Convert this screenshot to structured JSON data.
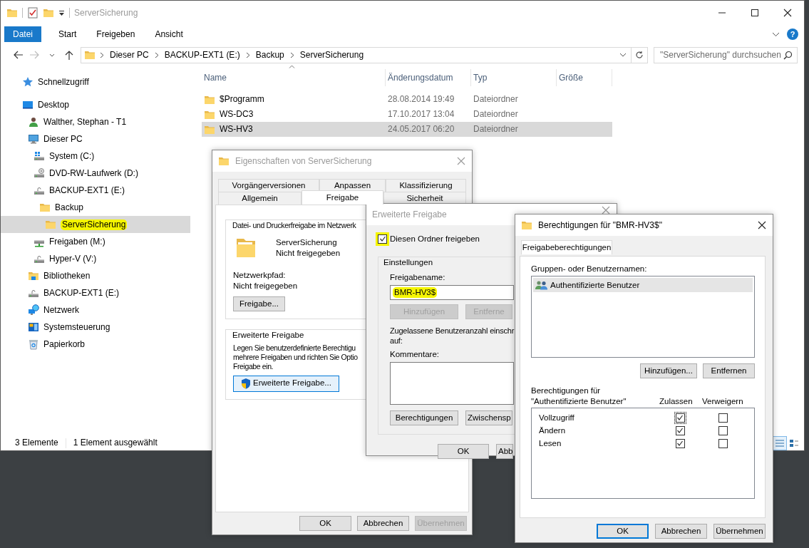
{
  "explorer": {
    "title": "ServerSicherung",
    "ribbon_tabs": [
      {
        "label": "Datei",
        "kind": "filemenu"
      },
      {
        "label": "Start",
        "kind": "tab"
      },
      {
        "label": "Freigeben",
        "kind": "tab"
      },
      {
        "label": "Ansicht",
        "kind": "tab"
      }
    ],
    "help_button": "?",
    "address": {
      "path": [
        "Dieser PC",
        "BACKUP-EXT1 (E:)",
        "Backup",
        "ServerSicherung"
      ]
    },
    "search": {
      "placeholder": "\"ServerSicherung\" durchsuchen"
    },
    "sidebar": {
      "items": [
        {
          "label": "Schnellzugriff",
          "kind": "pinned",
          "selected": false,
          "highlighted": false
        },
        {
          "label": "Desktop",
          "kind": "desktop",
          "selected": false,
          "highlighted": false,
          "children": [
            {
              "label": "Walther, Stephan - T1",
              "kind": "user",
              "selected": false,
              "highlighted": false
            },
            {
              "label": "Dieser PC",
              "kind": "computer",
              "selected": false,
              "highlighted": false,
              "children": [
                {
                  "label": "System (C:)",
                  "kind": "systemdrive",
                  "selected": false,
                  "highlighted": false
                },
                {
                  "label": "DVD-RW-Laufwerk (D:)",
                  "kind": "opticaldrive",
                  "selected": false,
                  "highlighted": false
                },
                {
                  "label": "BACKUP-EXT1 (E:)",
                  "kind": "drive",
                  "selected": false,
                  "highlighted": false,
                  "children": [
                    {
                      "label": "Backup",
                      "kind": "folder",
                      "selected": false,
                      "highlighted": false,
                      "children": [
                        {
                          "label": "ServerSicherung",
                          "kind": "folder",
                          "selected": true,
                          "highlighted": true
                        }
                      ]
                    }
                  ]
                },
                {
                  "label": "Freigaben (M:)",
                  "kind": "networkdrive",
                  "selected": false,
                  "highlighted": false
                },
                {
                  "label": "Hyper-V (V:)",
                  "kind": "drive",
                  "selected": false,
                  "highlighted": false
                }
              ]
            },
            {
              "label": "Bibliotheken",
              "kind": "library",
              "selected": false,
              "highlighted": false
            },
            {
              "label": "BACKUP-EXT1 (E:)",
              "kind": "drive",
              "selected": false,
              "highlighted": false
            },
            {
              "label": "Netzwerk",
              "kind": "network",
              "selected": false,
              "highlighted": false
            },
            {
              "label": "Systemsteuerung",
              "kind": "controlpanel",
              "selected": false,
              "highlighted": false
            },
            {
              "label": "Papierkorb",
              "kind": "recyclebin",
              "selected": false,
              "highlighted": false
            }
          ]
        }
      ]
    },
    "file_list": {
      "columns": [
        "Name",
        "Änderungsdatum",
        "Typ",
        "Größe"
      ],
      "rows": [
        {
          "name": "$Programm",
          "modified": "28.08.2014 19:49",
          "type": "Dateiordner",
          "selected": false
        },
        {
          "name": "WS-DC3",
          "modified": "17.10.2017 13:04",
          "type": "Dateiordner",
          "selected": false
        },
        {
          "name": "WS-HV3",
          "modified": "24.05.2017 06:20",
          "type": "Dateiordner",
          "selected": true
        }
      ]
    },
    "status_bar": {
      "item_count": "3 Elemente",
      "selection": "1 Element ausgewählt"
    }
  },
  "properties_dialog": {
    "title": "Eigenschaften von ServerSicherung",
    "active": false,
    "tab_rows": [
      {
        "tabs": [
          {
            "label": "Vorgängerversionen",
            "selected": false
          },
          {
            "label": "Anpassen",
            "selected": false
          },
          {
            "label": "Klassifizierung",
            "selected": false
          }
        ]
      },
      {
        "tabs": [
          {
            "label": "Allgemein",
            "selected": false
          },
          {
            "label": "Freigabe",
            "selected": true
          },
          {
            "label": "Sicherheit",
            "selected": false
          }
        ]
      }
    ],
    "network_sharing": {
      "heading": "Datei- und Druckerfreigabe im Netzwerk",
      "folder_name": "ServerSicherung",
      "share_state": "Nicht freigegeben",
      "path_label": "Netzwerkpfad:",
      "path": "Nicht freigegeben",
      "button": "Freigabe..."
    },
    "advanced_sharing": {
      "heading": "Erweiterte Freigabe",
      "description": "Legen Sie benutzerdefinierte Berechtigu\nmehrere Freigaben und richten Sie Optio\nFreigabe ein.",
      "button": "Erweiterte Freigabe..."
    },
    "buttons": [
      {
        "label": "OK",
        "disabled": false
      },
      {
        "label": "Abbrechen",
        "disabled": false
      },
      {
        "label": "Übernehmen",
        "disabled": true
      }
    ]
  },
  "advanced_sharing_dialog": {
    "title": "Erweiterte Freigabe",
    "active": false,
    "share_checkbox": {
      "label": "Diesen Ordner freigeben",
      "checked": true,
      "highlighted": true
    },
    "settings": {
      "heading": "Einstellungen",
      "share_name_label": "Freigabename:",
      "share_name": {
        "value": "BMR-HV3$",
        "highlighted": true
      },
      "name_buttons": [
        {
          "label": "Hinzufügen",
          "disabled": true
        },
        {
          "label": "Entferne",
          "disabled": true
        }
      ],
      "user_limit_label": "Zugelassene Benutzeranzahl einschr\nauf:",
      "comments_label": "Kommentare:",
      "buttons": [
        {
          "label": "Berechtigungen",
          "disabled": false
        },
        {
          "label": "Zwischensp",
          "disabled": false
        }
      ]
    },
    "buttons": [
      {
        "label": "OK",
        "disabled": false
      },
      {
        "label": "Abb",
        "disabled": false
      }
    ]
  },
  "permissions_dialog": {
    "title": "Berechtigungen für \"BMR-HV3$\"",
    "active": true,
    "tabs": [
      {
        "label": "Freigabeberechtigungen",
        "selected": true
      }
    ],
    "groups_label": "Gruppen- oder Benutzernamen:",
    "principals": [
      {
        "name": "Authentifizierte Benutzer",
        "selected": true
      }
    ],
    "principal_buttons": [
      "Hinzufügen...",
      "Entfernen"
    ],
    "permissions_label": "Berechtigungen für \"Authentifizierte Benutzer\"",
    "columns": [
      "Zulassen",
      "Verweigern"
    ],
    "permissions": [
      {
        "name": "Vollzugriff",
        "allow": true,
        "deny": false,
        "focused": true
      },
      {
        "name": "Ändern",
        "allow": true,
        "deny": false,
        "focused": false
      },
      {
        "name": "Lesen",
        "allow": true,
        "deny": false,
        "focused": false
      }
    ],
    "buttons": [
      {
        "label": "OK",
        "default": true
      },
      {
        "label": "Abbrechen",
        "default": false
      },
      {
        "label": "Übernehmen",
        "default": false
      }
    ]
  }
}
